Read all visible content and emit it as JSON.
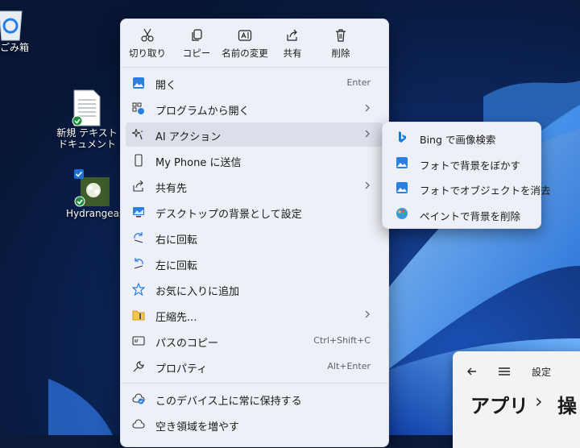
{
  "desktop": {
    "recycle_bin_label": "ごみ箱",
    "new_text_doc_label": "新規 テキスト ドキュメント",
    "image_file_label": "Hydrangeas"
  },
  "toolbar": {
    "cut": "切り取り",
    "copy": "コピー",
    "rename": "名前の変更",
    "share": "共有",
    "delete": "削除"
  },
  "menu": {
    "items": [
      {
        "label": "開く",
        "shortcut": "Enter",
        "icon": "open-photo-icon"
      },
      {
        "label": "プログラムから開く",
        "icon": "open-with-icon",
        "has_submenu": true
      },
      {
        "label": "AI アクション",
        "icon": "ai-sparkle-icon",
        "has_submenu": true,
        "highlighted": true
      },
      {
        "label": "My Phone に送信",
        "icon": "phone-icon"
      },
      {
        "label": "共有先",
        "icon": "share-icon",
        "has_submenu": true
      },
      {
        "label": "デスクトップの背景として設定",
        "icon": "wallpaper-icon"
      },
      {
        "label": "右に回転",
        "icon": "rotate-right-icon"
      },
      {
        "label": "左に回転",
        "icon": "rotate-left-icon"
      },
      {
        "label": "お気に入りに追加",
        "icon": "star-icon"
      },
      {
        "label": "圧縮先...",
        "icon": "zip-icon",
        "has_submenu": true
      },
      {
        "label": "パスのコピー",
        "shortcut": "Ctrl+Shift+C",
        "icon": "copy-path-icon"
      },
      {
        "label": "プロパティ",
        "shortcut": "Alt+Enter",
        "icon": "wrench-icon"
      },
      {
        "label": "このデバイス上に常に保持する",
        "icon": "cloud-pin-icon"
      },
      {
        "label": "空き領域を増やす",
        "icon": "cloud-icon"
      }
    ]
  },
  "ai_submenu": {
    "items": [
      {
        "label": "Bing で画像検索",
        "icon": "bing-icon"
      },
      {
        "label": "フォトで背景をぼかす",
        "icon": "photos-icon"
      },
      {
        "label": "フォトでオブジェクトを消去",
        "icon": "photos-icon"
      },
      {
        "label": "ペイントで背景を削除",
        "icon": "paint-icon"
      }
    ]
  },
  "settings_window": {
    "title": "設定",
    "breadcrumb_1": "アプリ",
    "breadcrumb_sep": "›",
    "breadcrumb_2": "操"
  },
  "colors": {
    "accent": "#0067c0",
    "menu_bg": "#eef0f7",
    "highlight": "#dcdfea"
  }
}
